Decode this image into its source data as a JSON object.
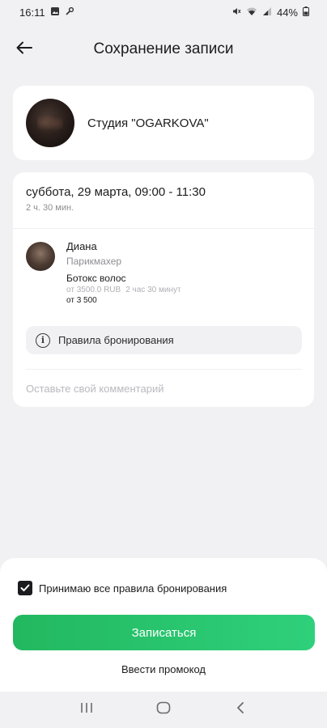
{
  "status_bar": {
    "time": "16:11",
    "battery": "44%",
    "icons_left": [
      "gallery-icon",
      "wrench-icon"
    ],
    "icons_right": [
      "mute-icon",
      "wifi-icon",
      "signal-icon",
      "battery-icon"
    ]
  },
  "header": {
    "title": "Сохранение записи",
    "back_icon": "arrow-left-icon"
  },
  "studio": {
    "name": "Студия \"OGARKOVA\""
  },
  "appointment": {
    "date": "суббота, 29 марта, 09:00 - 11:30",
    "duration": "2 ч. 30 мин."
  },
  "master": {
    "name": "Диана",
    "role": "Парикмахер"
  },
  "service": {
    "name": "Ботокс волос",
    "price_from": "от 3500.0 RUB",
    "duration": "2 час 30 минут",
    "total": "от 3 500"
  },
  "rules": {
    "label": "Правила бронирования",
    "icon": "info-icon"
  },
  "comment": {
    "placeholder": "Оставьте свой комментарий",
    "value": ""
  },
  "footer": {
    "agree_label": "Принимаю все правила бронирования",
    "agree_checked": true,
    "submit_label": "Записаться",
    "promo_label": "Ввести промокод"
  },
  "colors": {
    "accent_start": "#22b860",
    "accent_end": "#2fd07b",
    "background": "#f1f1f4"
  },
  "nav": {
    "icons": [
      "recent-apps-icon",
      "home-icon",
      "back-icon"
    ]
  }
}
